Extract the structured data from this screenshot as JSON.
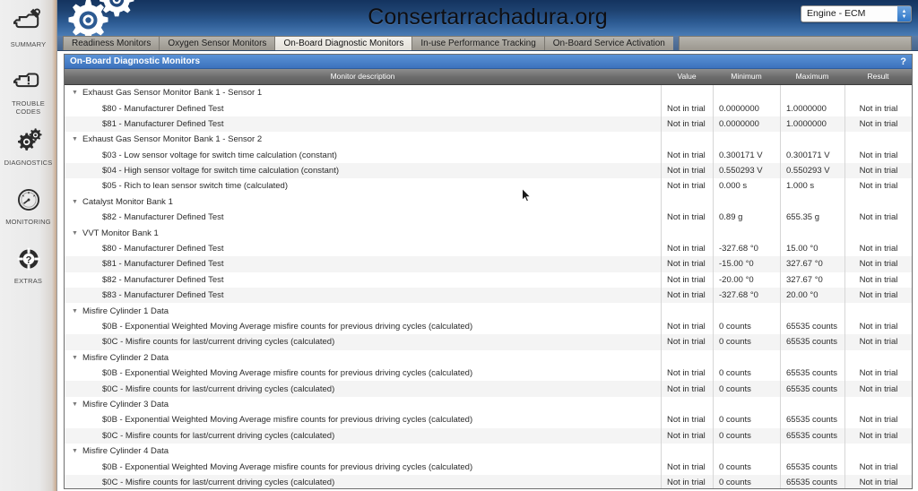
{
  "sidebar": {
    "items": [
      {
        "label": "SUMMARY",
        "icon": "engine-wrench-icon"
      },
      {
        "label": "TROUBLE CODES",
        "icon": "engine-warning-icon"
      },
      {
        "label": "DIAGNOSTICS",
        "icon": "gears-icon"
      },
      {
        "label": "MONITORING",
        "icon": "gauge-icon"
      },
      {
        "label": "EXTRAS",
        "icon": "lifebuoy-question-icon"
      }
    ]
  },
  "header": {
    "site_title": "Consertarrachadura.org",
    "logo_icon": "gears-logo-icon",
    "ecu_select": {
      "value": "Engine - ECM",
      "stepper_icon": "stepper-updown-icon"
    }
  },
  "tabs": [
    {
      "label": "Readiness Monitors",
      "active": false
    },
    {
      "label": "Oxygen Sensor Monitors",
      "active": false
    },
    {
      "label": "On-Board Diagnostic Monitors",
      "active": true
    },
    {
      "label": "In-use Performance Tracking",
      "active": false
    },
    {
      "label": "On-Board Service Activation",
      "active": false
    }
  ],
  "panel": {
    "title": "On-Board Diagnostic Monitors",
    "help_label": "?",
    "columns": [
      "Monitor description",
      "Value",
      "Minimum",
      "Maximum",
      "Result"
    ],
    "rows": [
      {
        "type": "group",
        "desc": "Exhaust Gas Sensor Monitor Bank 1 - Sensor 1"
      },
      {
        "type": "item",
        "desc": "$80 - Manufacturer Defined Test",
        "value": "Not in trial",
        "min": "0.0000000",
        "max": "1.0000000",
        "result": "Not in trial"
      },
      {
        "type": "item",
        "desc": "$81 - Manufacturer Defined Test",
        "value": "Not in trial",
        "min": "0.0000000",
        "max": "1.0000000",
        "result": "Not in trial"
      },
      {
        "type": "group",
        "desc": "Exhaust Gas Sensor Monitor Bank 1 - Sensor 2"
      },
      {
        "type": "item",
        "desc": "$03 - Low sensor voltage for switch time calculation (constant)",
        "value": "Not in trial",
        "min": "0.300171 V",
        "max": "0.300171 V",
        "result": "Not in trial"
      },
      {
        "type": "item",
        "desc": "$04 - High sensor voltage for switch time calculation (constant)",
        "value": "Not in trial",
        "min": "0.550293 V",
        "max": "0.550293 V",
        "result": "Not in trial"
      },
      {
        "type": "item",
        "desc": "$05 - Rich to lean sensor switch time (calculated)",
        "value": "Not in trial",
        "min": "0.000 s",
        "max": "1.000 s",
        "result": "Not in trial"
      },
      {
        "type": "group",
        "desc": "Catalyst Monitor Bank 1"
      },
      {
        "type": "item",
        "desc": "$82 - Manufacturer Defined Test",
        "value": "Not in trial",
        "min": "0.89 g",
        "max": "655.35 g",
        "result": "Not in trial"
      },
      {
        "type": "group",
        "desc": "VVT Monitor Bank 1"
      },
      {
        "type": "item",
        "desc": "$80 - Manufacturer Defined Test",
        "value": "Not in trial",
        "min": "-327.68 °0",
        "max": "15.00 °0",
        "result": "Not in trial"
      },
      {
        "type": "item",
        "desc": "$81 - Manufacturer Defined Test",
        "value": "Not in trial",
        "min": "-15.00 °0",
        "max": "327.67 °0",
        "result": "Not in trial"
      },
      {
        "type": "item",
        "desc": "$82 - Manufacturer Defined Test",
        "value": "Not in trial",
        "min": "-20.00 °0",
        "max": "327.67 °0",
        "result": "Not in trial"
      },
      {
        "type": "item",
        "desc": "$83 - Manufacturer Defined Test",
        "value": "Not in trial",
        "min": "-327.68 °0",
        "max": "20.00 °0",
        "result": "Not in trial"
      },
      {
        "type": "group",
        "desc": "Misfire Cylinder 1 Data"
      },
      {
        "type": "item",
        "desc": "$0B - Exponential Weighted Moving Average misfire counts for previous driving cycles (calculated)",
        "value": "Not in trial",
        "min": "0 counts",
        "max": "65535 counts",
        "result": "Not in trial"
      },
      {
        "type": "item",
        "desc": "$0C - Misfire counts for last/current driving cycles (calculated)",
        "value": "Not in trial",
        "min": "0 counts",
        "max": "65535 counts",
        "result": "Not in trial"
      },
      {
        "type": "group",
        "desc": "Misfire Cylinder 2 Data"
      },
      {
        "type": "item",
        "desc": "$0B - Exponential Weighted Moving Average misfire counts for previous driving cycles (calculated)",
        "value": "Not in trial",
        "min": "0 counts",
        "max": "65535 counts",
        "result": "Not in trial"
      },
      {
        "type": "item",
        "desc": "$0C - Misfire counts for last/current driving cycles (calculated)",
        "value": "Not in trial",
        "min": "0 counts",
        "max": "65535 counts",
        "result": "Not in trial"
      },
      {
        "type": "group",
        "desc": "Misfire Cylinder 3 Data"
      },
      {
        "type": "item",
        "desc": "$0B - Exponential Weighted Moving Average misfire counts for previous driving cycles (calculated)",
        "value": "Not in trial",
        "min": "0 counts",
        "max": "65535 counts",
        "result": "Not in trial"
      },
      {
        "type": "item",
        "desc": "$0C - Misfire counts for last/current driving cycles (calculated)",
        "value": "Not in trial",
        "min": "0 counts",
        "max": "65535 counts",
        "result": "Not in trial"
      },
      {
        "type": "group",
        "desc": "Misfire Cylinder 4 Data"
      },
      {
        "type": "item",
        "desc": "$0B - Exponential Weighted Moving Average misfire counts for previous driving cycles (calculated)",
        "value": "Not in trial",
        "min": "0 counts",
        "max": "65535 counts",
        "result": "Not in trial"
      },
      {
        "type": "item",
        "desc": "$0C - Misfire counts for last/current driving cycles (calculated)",
        "value": "Not in trial",
        "min": "0 counts",
        "max": "65535 counts",
        "result": "Not in trial"
      }
    ]
  },
  "colors": {
    "panel_title_blue": "#3c72bd",
    "banner_top": "#14335f",
    "banner_bottom": "#4a7cb5",
    "column_header_gray": "#6b6b6b"
  }
}
